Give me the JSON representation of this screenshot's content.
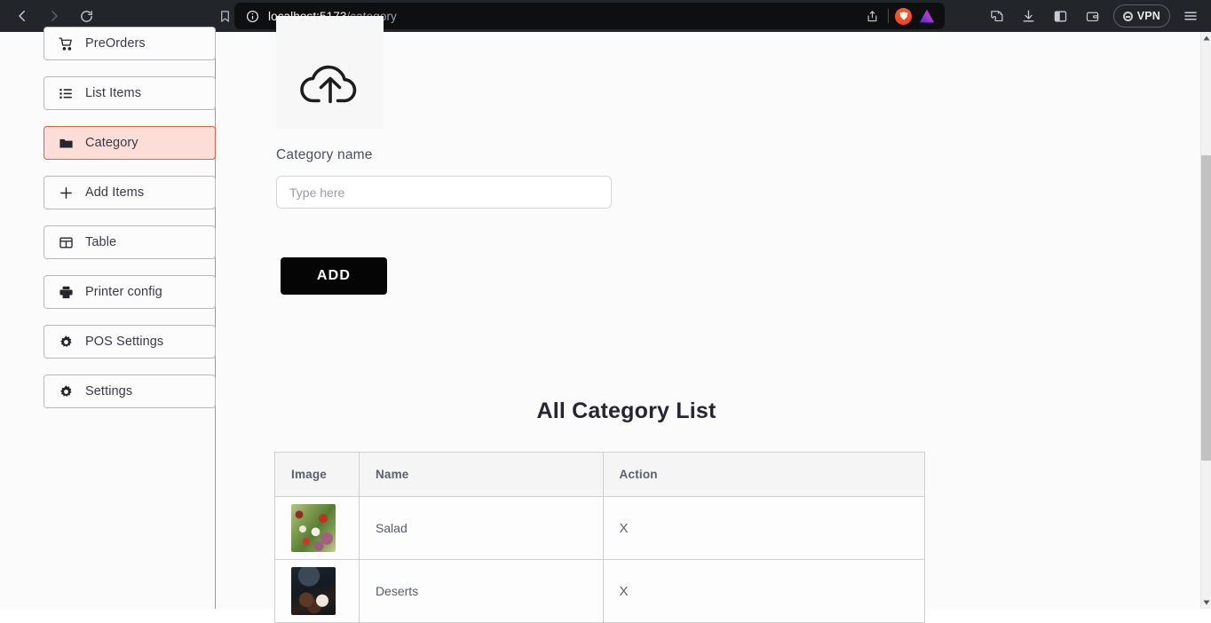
{
  "browser": {
    "back_label": "Back",
    "forward_label": "Forward",
    "reload_label": "Reload",
    "bookmark_label": "Bookmark",
    "url_host": "localhost:5173",
    "url_path": "/category",
    "share_label": "Share",
    "brave_label": "Brave Shields",
    "leo_label": "Leo AI",
    "extensions_label": "Extensions",
    "downloads_label": "Downloads",
    "sidebar_toggle_label": "Sidebar",
    "wallet_label": "Wallet",
    "vpn_label": "VPN",
    "menu_label": "Menu"
  },
  "sidebar": {
    "items": [
      {
        "label": "PreOrders",
        "icon": "shopping-cart-icon",
        "active": false
      },
      {
        "label": "List Items",
        "icon": "list-icon",
        "active": false
      },
      {
        "label": "Category",
        "icon": "folder-icon",
        "active": true
      },
      {
        "label": "Add Items",
        "icon": "plus-icon",
        "active": false
      },
      {
        "label": "Table",
        "icon": "table-icon",
        "active": false
      },
      {
        "label": "Printer config",
        "icon": "printer-icon",
        "active": false
      },
      {
        "label": "POS Settings",
        "icon": "gear-icon",
        "active": false
      },
      {
        "label": "Settings",
        "icon": "gear-icon",
        "active": false
      }
    ]
  },
  "main": {
    "upload": {
      "icon": "cloud-upload-icon"
    },
    "form": {
      "label": "Category name",
      "placeholder": "Type here",
      "value": "",
      "submit_label": "ADD"
    },
    "list": {
      "title": "All Category List",
      "columns": [
        "Image",
        "Name",
        "Action"
      ],
      "rows": [
        {
          "image": "salad-thumbnail",
          "name": "Salad",
          "action": "X"
        },
        {
          "image": "dessert-thumbnail",
          "name": "Deserts",
          "action": "X"
        }
      ]
    }
  },
  "colors": {
    "accent": "#f05a3f",
    "accent_bg": "#fdddd8",
    "button": "#050505",
    "chrome": "#222529",
    "page_bg": "#fbfbfb"
  }
}
